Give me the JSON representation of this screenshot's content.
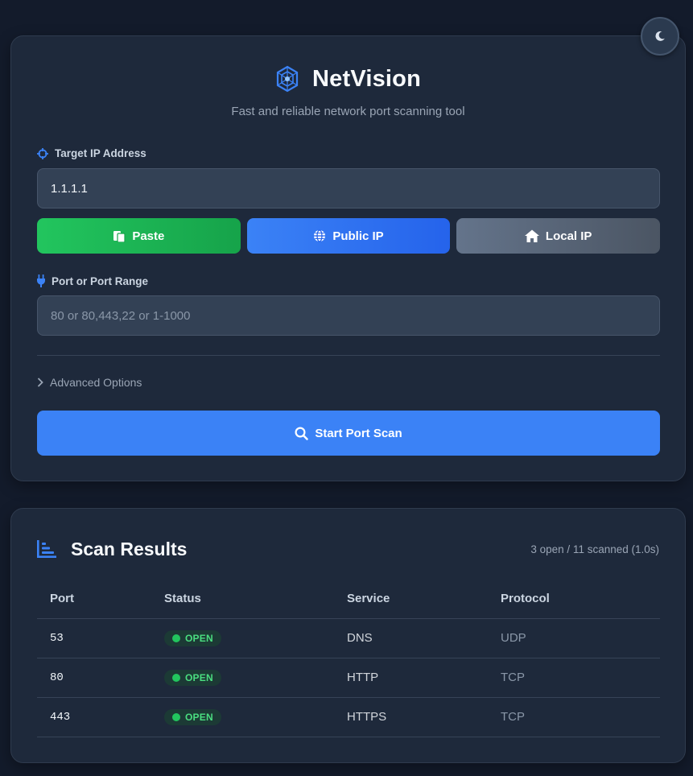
{
  "theme_toggle": {
    "icon": "moon-icon"
  },
  "app": {
    "title": "NetVision",
    "subtitle": "Fast and reliable network port scanning tool",
    "logo_icon": "network-cube-icon"
  },
  "form": {
    "ip_label": "Target IP Address",
    "ip_value": "1.1.1.1",
    "buttons": {
      "paste": "Paste",
      "public_ip": "Public IP",
      "local_ip": "Local IP"
    },
    "port_label": "Port or Port Range",
    "port_placeholder": "80 or 80,443,22 or 1-1000",
    "port_value": "",
    "advanced_label": "Advanced Options",
    "scan_button": "Start Port Scan"
  },
  "results": {
    "title": "Scan Results",
    "summary": "3 open / 11 scanned (1.0s)",
    "columns": [
      "Port",
      "Status",
      "Service",
      "Protocol"
    ],
    "rows": [
      {
        "port": "53",
        "status": "OPEN",
        "service": "DNS",
        "protocol": "UDP"
      },
      {
        "port": "80",
        "status": "OPEN",
        "service": "HTTP",
        "protocol": "TCP"
      },
      {
        "port": "443",
        "status": "OPEN",
        "service": "HTTPS",
        "protocol": "TCP"
      }
    ]
  },
  "colors": {
    "accent": "#3b82f6",
    "success": "#22c55e",
    "background": "#131b2b",
    "card": "#1e293b"
  }
}
